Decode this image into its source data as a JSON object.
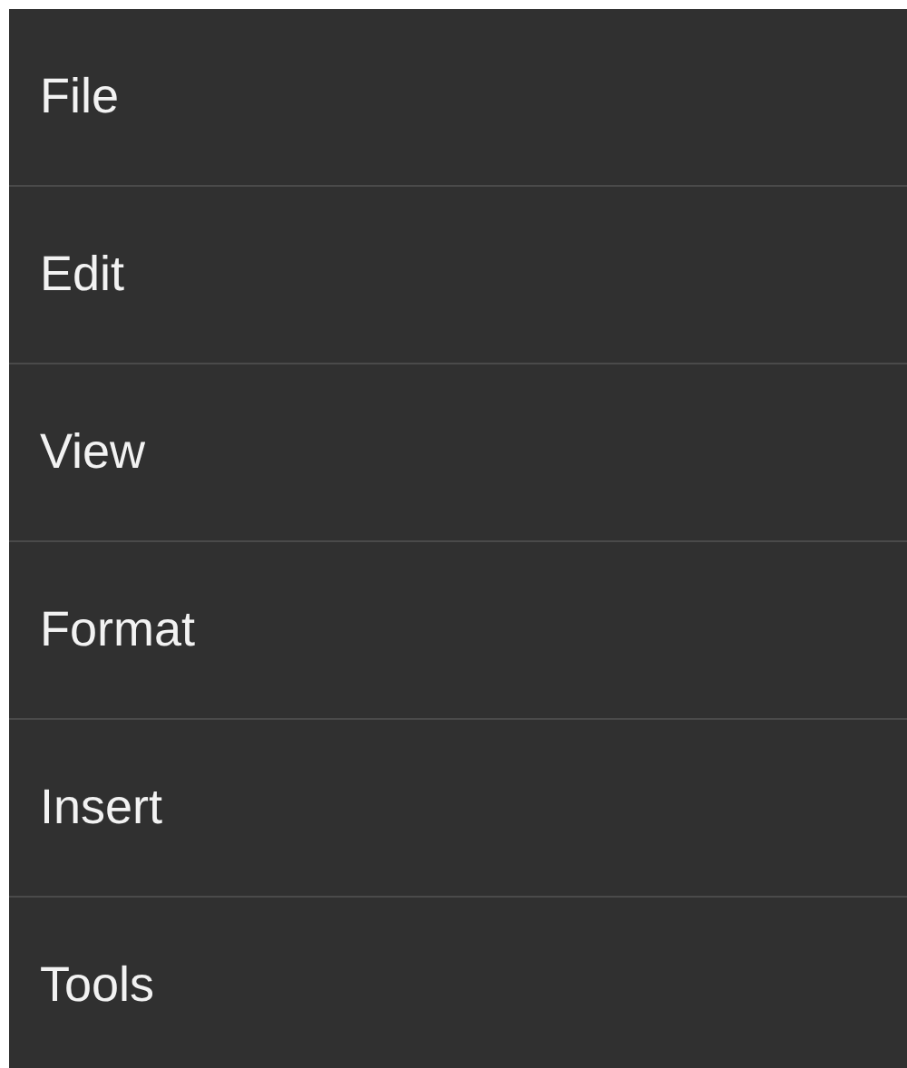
{
  "menu": {
    "items": [
      {
        "label": "File"
      },
      {
        "label": "Edit"
      },
      {
        "label": "View"
      },
      {
        "label": "Format"
      },
      {
        "label": "Insert"
      },
      {
        "label": "Tools"
      }
    ]
  }
}
